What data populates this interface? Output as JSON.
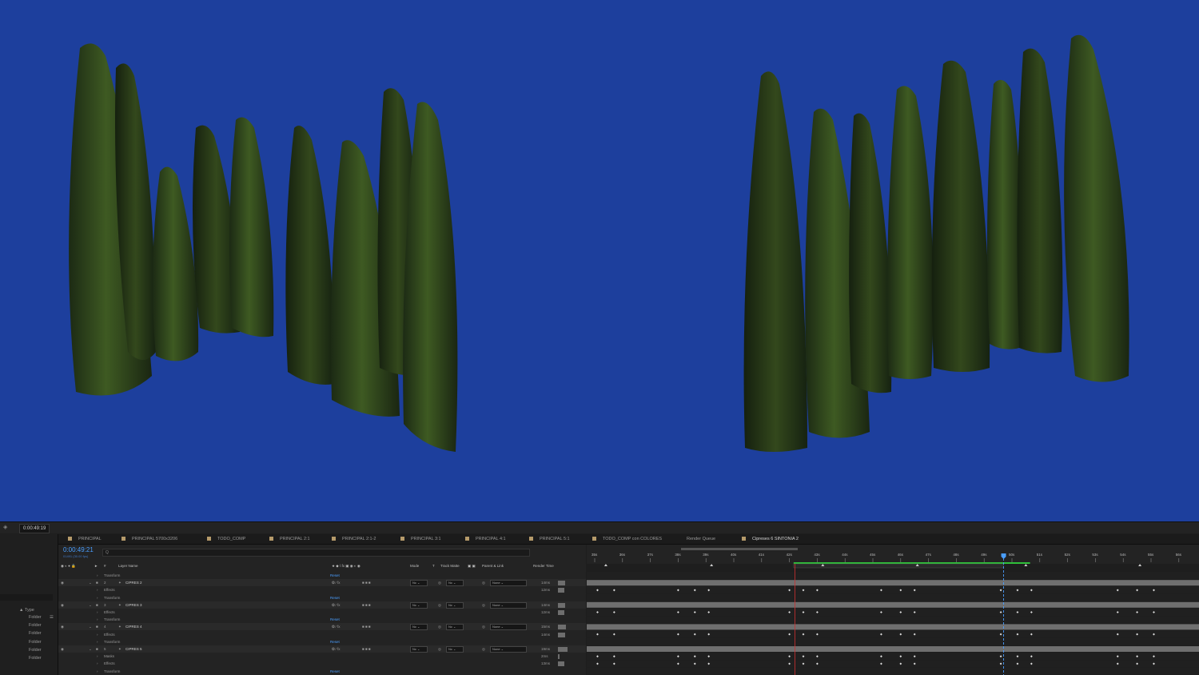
{
  "statusbar": {
    "timecode": "0:00:49:19"
  },
  "tabs": [
    {
      "label": "PRINCIPAL",
      "swatch": true
    },
    {
      "label": "PRINCIPAL 5700x3206",
      "swatch": true
    },
    {
      "label": "TODO_COMP",
      "swatch": true
    },
    {
      "label": "PRINCIPAL 2:1",
      "swatch": true
    },
    {
      "label": "PRINCIPAL 2:1-2",
      "swatch": true
    },
    {
      "label": "PRINCIPAL 3:1",
      "swatch": true
    },
    {
      "label": "PRINCIPAL 4:1",
      "swatch": true
    },
    {
      "label": "PRINCIPAL 5:1",
      "swatch": true
    },
    {
      "label": "TODO_COMP con COLORES",
      "swatch": true
    },
    {
      "label": "Render Queue",
      "swatch": false
    },
    {
      "label": "Cipreses 6 SINTONIA 2",
      "swatch": true,
      "active": true
    }
  ],
  "project_panel": {
    "type_header": "Type",
    "items": [
      "Folder",
      "Folder",
      "Folder",
      "Folder",
      "Folder",
      "Folder"
    ]
  },
  "timeline": {
    "current_time": "0:00:49:21",
    "current_time_sub": "01491 (30.00 fps)",
    "search_placeholder": "Q",
    "columns": {
      "num": "#",
      "layer_name": "Layer Name",
      "mode": "Mode",
      "t": "T",
      "track_matte": "Track Matte",
      "parent": "Parent & Link",
      "render_time": "Render Time"
    },
    "rows": [
      {
        "kind": "prop",
        "label": "Transform",
        "reset": "Reset"
      },
      {
        "kind": "layer",
        "num": "2",
        "name": "CIPRES 2",
        "mode": "Nc",
        "matte": "Nc",
        "parent": "None",
        "render": "14ms"
      },
      {
        "kind": "prop",
        "label": "Effects",
        "render": "12ms"
      },
      {
        "kind": "prop",
        "label": "Transform",
        "reset": "Reset"
      },
      {
        "kind": "layer",
        "num": "3",
        "name": "CIPRES 3",
        "mode": "Nc",
        "matte": "Nc",
        "parent": "None",
        "render": "14ms"
      },
      {
        "kind": "prop",
        "label": "Effects",
        "render": "12ms"
      },
      {
        "kind": "prop",
        "label": "Transform",
        "reset": "Reset"
      },
      {
        "kind": "layer",
        "num": "4",
        "name": "CIPRES 4",
        "mode": "Nc",
        "matte": "Nc",
        "parent": "None",
        "render": "15ms"
      },
      {
        "kind": "prop",
        "label": "Effects",
        "render": "14ms"
      },
      {
        "kind": "prop",
        "label": "Transform",
        "reset": "Reset"
      },
      {
        "kind": "layer",
        "num": "5",
        "name": "CIPRES 5",
        "mode": "Nc",
        "matte": "Nc",
        "parent": "None",
        "render": "19ms"
      },
      {
        "kind": "prop",
        "label": "Masks",
        "render": "2ms"
      },
      {
        "kind": "prop",
        "label": "Effects",
        "render": "13ms"
      },
      {
        "kind": "prop",
        "label": "Transform",
        "reset": "Reset"
      }
    ],
    "ruler": [
      "35s",
      "36s",
      "37s",
      "38s",
      "39s",
      "40s",
      "41s",
      "42s",
      "43s",
      "44s",
      "45s",
      "46s",
      "47s",
      "48s",
      "49s",
      "50s",
      "51s",
      "52s",
      "53s",
      "54s",
      "55s",
      "56s"
    ]
  },
  "colors": {
    "viewer_bg": "#1d3f9d",
    "timecode": "#4a9eff",
    "work_area": "#2fbf3a",
    "playhead": "#4a9eff",
    "current_line": "#d03030"
  }
}
